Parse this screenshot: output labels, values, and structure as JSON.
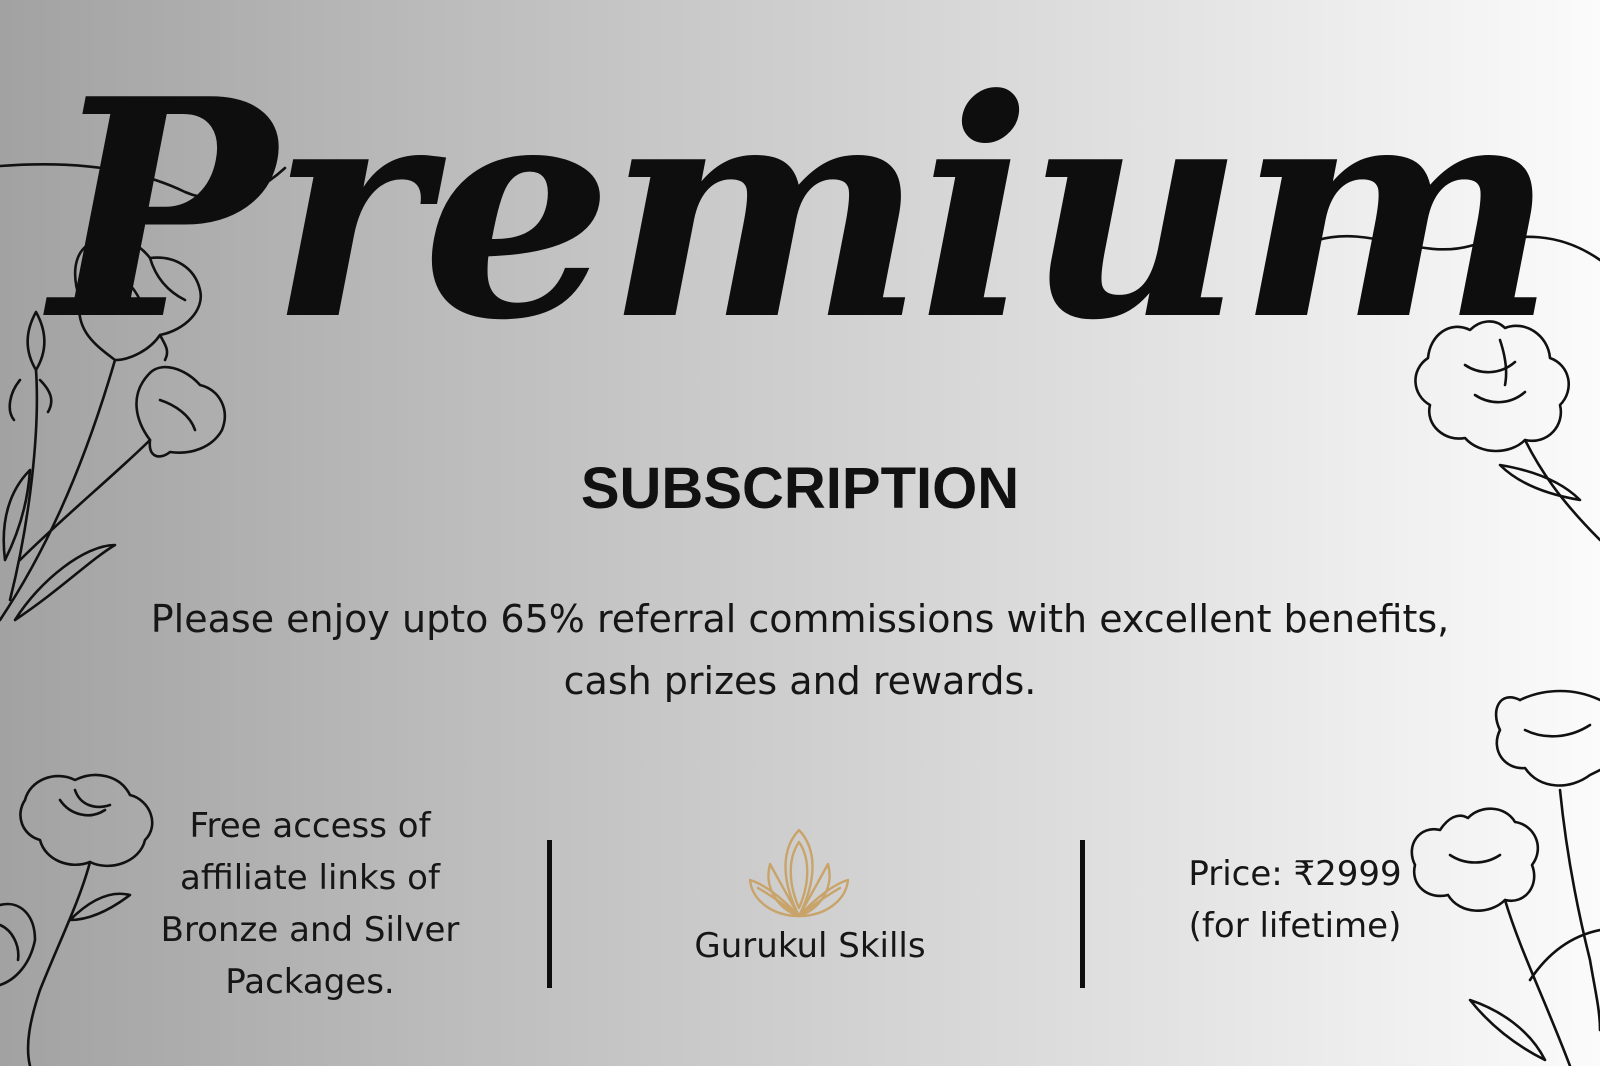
{
  "title": "Premium",
  "subtitle": "SUBSCRIPTION",
  "description": "Please enjoy upto 65% referral commissions  with excellent benefits, cash prizes and rewards.",
  "features": {
    "left": "Free access of affiliate links of Bronze and Silver Packages.",
    "brand_name": "Gurukul Skills",
    "price_line": "Price: ₹2999",
    "price_note": "(for lifetime)"
  },
  "logo_icon": "lotus-icon",
  "colors": {
    "text": "#111111",
    "logo_gold": "#c9a46a",
    "background_left": "#a2a2a2",
    "background_right": "#fbfbfb"
  }
}
